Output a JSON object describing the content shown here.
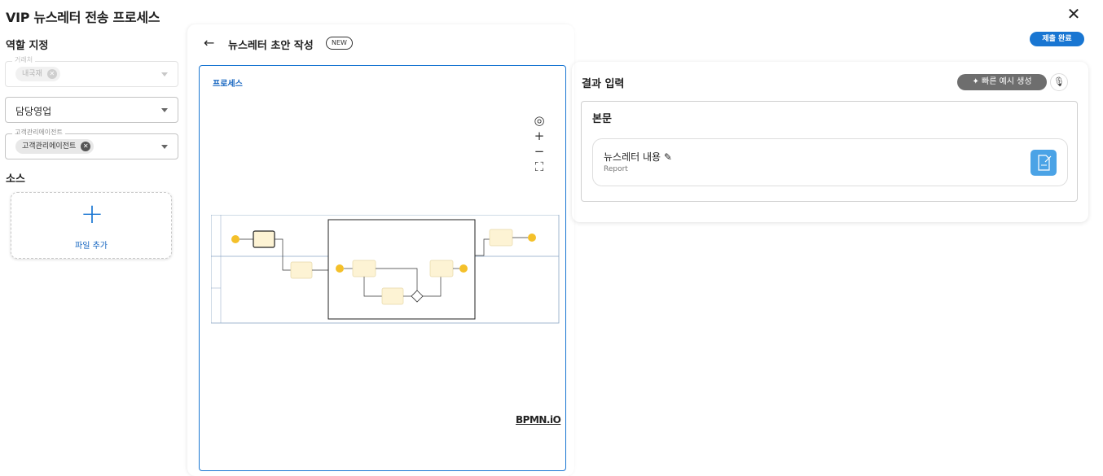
{
  "window": {
    "title": "VIP 뉴스레터 전송 프로세스",
    "close_icon": "close-icon"
  },
  "left": {
    "role_header": "역할 지정",
    "role_fields": [
      {
        "legend": "거래처",
        "chip": "내국재",
        "disabled": true
      },
      {
        "legend": "",
        "value": "담당영업",
        "disabled": false
      },
      {
        "legend": "고객관리에이전트",
        "chip": "고객관리에이전트",
        "disabled": false
      }
    ],
    "source_header": "소스",
    "upload_label": "파일 추가"
  },
  "center": {
    "step_title": "뉴스레터 초안 작성",
    "new_badge": "NEW",
    "process_label": "프로세스",
    "zoom_controls": [
      "focus-icon",
      "zoom-in-icon",
      "zoom-out-icon",
      "fit-icon"
    ],
    "bpmn_logo": "BPMN.iO"
  },
  "right": {
    "submit_label": "제출 완료",
    "result_title": "결과 입력",
    "quick_example_label": "빠른 예시 생성",
    "body_label": "본문",
    "item_name": "뉴스레터 내용",
    "item_type": "Report"
  },
  "colors": {
    "accent": "#1976d2",
    "event": "#f4c02a",
    "task": "#fdf3d4"
  }
}
